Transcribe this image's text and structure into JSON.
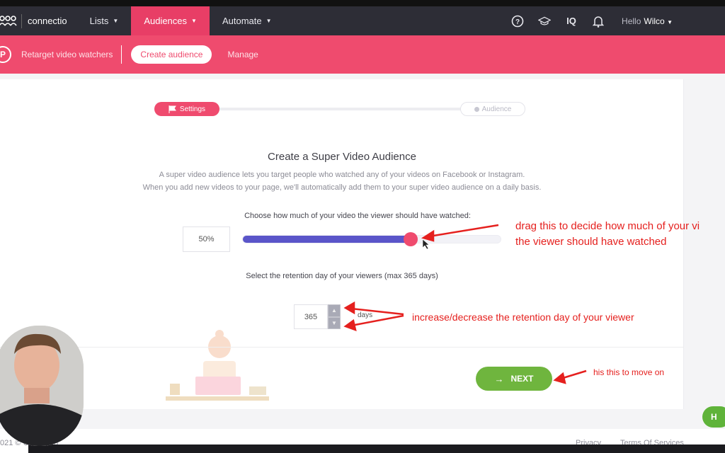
{
  "nav": {
    "brand": "connectio",
    "items": [
      {
        "label": "Lists"
      },
      {
        "label": "Audiences"
      },
      {
        "label": "Automate"
      }
    ],
    "icons": [
      "help-circle-icon",
      "graduation-cap-icon",
      "iq-icon",
      "bell-icon"
    ],
    "iq_label": "IQ",
    "greeting": "Hello",
    "user": "Wilco"
  },
  "subnav": {
    "title": "Retarget video watchers",
    "create_button": "Create audience",
    "manage": "Manage",
    "logo_letter": "P"
  },
  "stepper": {
    "step1": "Settings",
    "step2": "Audience"
  },
  "content": {
    "heading": "Create a Super Video Audience",
    "desc_line1": "A super video audience lets you target people who watched any of your videos on Facebook or Instagram.",
    "desc_line2": "When you add new videos to your page, we'll automatically add them to your super video audience on a daily basis.",
    "slider_label": "Choose how much of your video the viewer should have watched:",
    "percent_value": "50%",
    "percent_fraction": 0.65,
    "retention_label": "Select the retention day of your viewers (max 365 days)",
    "days_value": "365",
    "days_unit": "days",
    "next_button": "NEXT"
  },
  "annotations": {
    "slider_line1": "drag this to decide how much of your vi",
    "slider_line2": "the viewer should have watched",
    "retention": "increase/decrease the retention day of your viewer",
    "next": "his this to move on"
  },
  "footer": {
    "copyright": "021 © Connectio",
    "privacy": "Privacy",
    "terms": "Terms Of Services",
    "help": "H"
  },
  "colors": {
    "nav_bg": "#2d2d36",
    "accent": "#ef4b6e",
    "slider": "#5a55c9",
    "next": "#6fb53e",
    "annotation": "#e5201e"
  }
}
